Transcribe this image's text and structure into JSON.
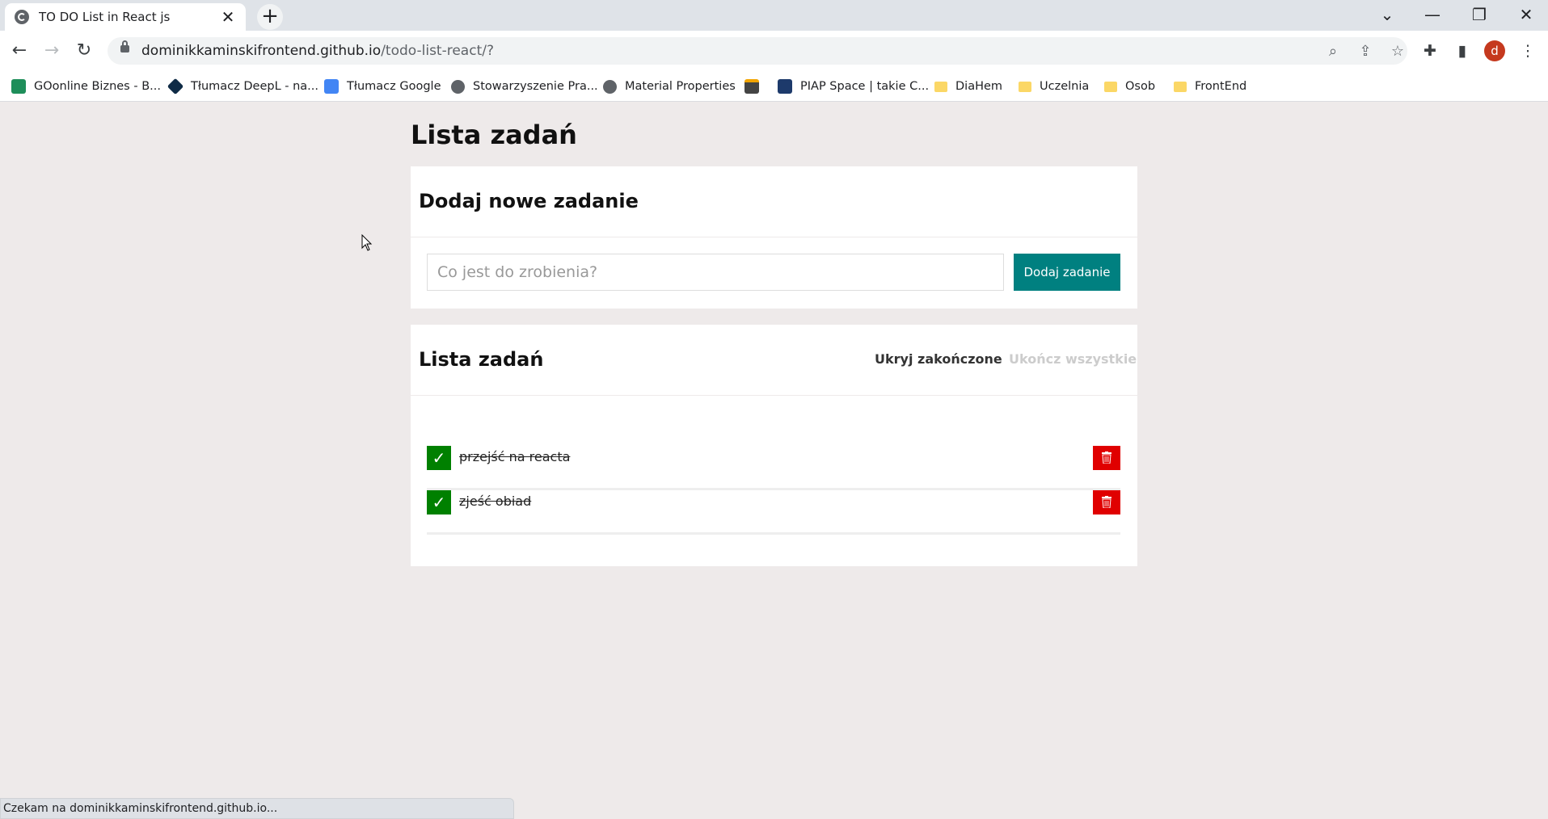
{
  "browser": {
    "tab_title": "TO DO List in React js",
    "tab_close": "✕",
    "new_tab": "+",
    "window_controls": {
      "chevron": "⌄",
      "minimize": "—",
      "restore": "❐",
      "close": "✕"
    },
    "nav": {
      "back": "←",
      "forward": "→",
      "reload": "↻"
    },
    "url_host": "dominikkaminskifrontend.github.io",
    "url_path": "/todo-list-react/?",
    "omnibox_icons": {
      "zoom": "⌕",
      "share": "⇪",
      "star": "☆"
    },
    "toolbar_icons": {
      "extensions": "✚",
      "sidepanel": "▮",
      "menu": "⋮"
    },
    "profile_initial": "d",
    "bookmarks": [
      {
        "label": "GOonline Biznes - B...",
        "icon": "green"
      },
      {
        "label": "Tłumacz DeepL - na...",
        "icon": "deepl"
      },
      {
        "label": "Tłumacz Google",
        "icon": "gtrans"
      },
      {
        "label": "Stowarzyszenie Pra...",
        "icon": "globe"
      },
      {
        "label": "Material Properties",
        "icon": "globe"
      },
      {
        "label": "",
        "icon": "bag"
      },
      {
        "label": "PIAP Space | takie C...",
        "icon": "piap"
      },
      {
        "label": "DiaHem",
        "icon": "folder"
      },
      {
        "label": "Uczelnia",
        "icon": "folder"
      },
      {
        "label": "Osob",
        "icon": "folder"
      },
      {
        "label": "FrontEnd",
        "icon": "folder"
      }
    ],
    "status_text": "Czekam na dominikkaminskifrontend.github.io..."
  },
  "app": {
    "title": "Lista zadań",
    "form": {
      "title": "Dodaj nowe zadanie",
      "input_placeholder": "Co jest do zrobienia?",
      "input_value": "",
      "button_label": "Dodaj zadanie"
    },
    "list": {
      "title": "Lista zadań",
      "hide_done_label": "Ukryj zakończone",
      "complete_all_label": "Ukończ wszystkie",
      "done_icon": "✓",
      "tasks": [
        {
          "content": "przejść na reacta",
          "done": true
        },
        {
          "content": "zjeść obiad",
          "done": true
        }
      ]
    },
    "colors": {
      "accent": "#008080",
      "done": "#008000",
      "delete": "#e00000",
      "background": "#eeeaea"
    }
  }
}
